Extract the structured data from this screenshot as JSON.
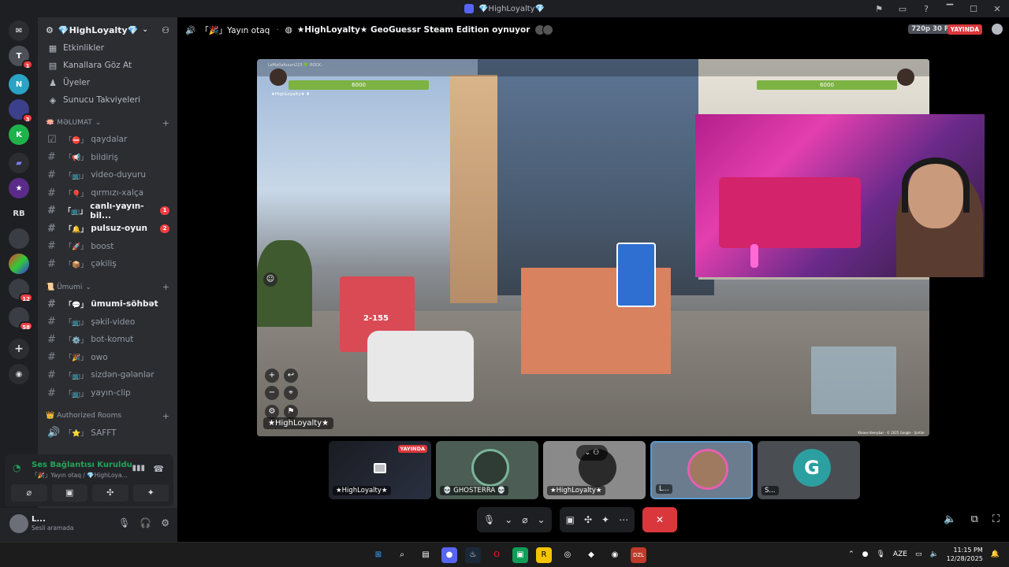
{
  "window": {
    "title": "💎HighLoyalty💎",
    "controls": [
      "▔",
      "☐",
      "✕"
    ]
  },
  "guilds": [
    {
      "label": "",
      "badge": ""
    },
    {
      "label": "T",
      "badge": "1"
    },
    {
      "label": "N",
      "badge": ""
    },
    {
      "label": "",
      "badge": "3"
    },
    {
      "label": "K",
      "badge": ""
    },
    {
      "label": "",
      "badge": ""
    },
    {
      "label": "",
      "badge": ""
    },
    {
      "label": "RB",
      "badge": ""
    },
    {
      "label": "",
      "badge": ""
    },
    {
      "label": "",
      "badge": ""
    },
    {
      "label": "",
      "badge": "12"
    },
    {
      "label": "",
      "badge": "58"
    }
  ],
  "server": {
    "name": "💎HighLoyalty💎",
    "nav": [
      {
        "icon": "calendar-icon",
        "label": "Etkinlikler"
      },
      {
        "icon": "browse-icon",
        "label": "Kanallara Göz At"
      },
      {
        "icon": "members-icon",
        "label": "Üyeler"
      },
      {
        "icon": "boost-icon",
        "label": "Sunucu Takviyeleri"
      }
    ],
    "categories": [
      {
        "name": "🪷 MƏLUMAT",
        "channels": [
          {
            "prefix": "「⛔」",
            "name": "qaydalar",
            "unread": false,
            "pill": ""
          },
          {
            "prefix": "「📢」",
            "name": "bildiriş",
            "unread": false,
            "pill": ""
          },
          {
            "prefix": "「📺」",
            "name": "video-duyuru",
            "unread": false,
            "pill": ""
          },
          {
            "prefix": "「🎈」",
            "name": "qırmızı-xalça",
            "unread": false,
            "pill": ""
          },
          {
            "prefix": "「📺」",
            "name": "canlı-yayın-bil...",
            "unread": true,
            "pill": "1"
          },
          {
            "prefix": "「🔔」",
            "name": "pulsuz-oyun",
            "unread": true,
            "pill": "2"
          },
          {
            "prefix": "「🚀」",
            "name": "boost",
            "unread": false,
            "pill": ""
          },
          {
            "prefix": "「📦」",
            "name": "çəkiliş",
            "unread": false,
            "pill": ""
          }
        ]
      },
      {
        "name": "📜 Ümumi",
        "channels": [
          {
            "prefix": "「💬」",
            "name": "ümumi-söhbət",
            "unread": true,
            "pill": ""
          },
          {
            "prefix": "「📺」",
            "name": "şəkil-video",
            "unread": false,
            "pill": ""
          },
          {
            "prefix": "「⚙️」",
            "name": "bot-komut",
            "unread": false,
            "pill": ""
          },
          {
            "prefix": "「🎉」",
            "name": "owo",
            "unread": false,
            "pill": ""
          },
          {
            "prefix": "「📺」",
            "name": "sizdən-gələnlər",
            "unread": false,
            "pill": ""
          },
          {
            "prefix": "「📺」",
            "name": "yayın-clip",
            "unread": false,
            "pill": ""
          }
        ]
      },
      {
        "name": "👑 Authorized Rooms",
        "channels": [
          {
            "prefix": "「⭐」",
            "name": "SAFFT",
            "unread": false,
            "pill": ""
          }
        ]
      }
    ]
  },
  "voice_panel": {
    "status": "Ses Bağlantısı Kuruldu",
    "channel": "「🎉」Yayın otaq / 💎HighLoya...",
    "buttons": [
      "⌀",
      "▣",
      "✣",
      "✦"
    ]
  },
  "user_panel": {
    "name": "L...",
    "status": "Sesli aramada"
  },
  "stage": {
    "channel": "「🎉」Yayın otaq",
    "activity": "★HighLoyalty★ GeoGuessr Steam Edition oynuyor",
    "quality": "720p 30 FPS",
    "live_label": "YAYINDA",
    "main_label": "★HighLoyalty★",
    "game": {
      "hp_left": "6000",
      "hp_right": "6000",
      "player_top": "LeMa0aAuum223  💚 ROCK  ·",
      "player_sub": "★HighLoyalty★ ♦",
      "bus_number": "2-155",
      "credit": "Kleave Keerybar · © 2025 Google · Şərtlər"
    },
    "tiles": [
      {
        "name": "★HighLoyalty★",
        "live": "YAYINDA",
        "kind": "screen"
      },
      {
        "name": "💀 GHOSTERRA 💀",
        "live": "",
        "kind": "avatar"
      },
      {
        "name": "★HighLoyalty★",
        "live": "",
        "kind": "avatar"
      },
      {
        "name": "L...",
        "live": "",
        "kind": "avatar-active"
      },
      {
        "name": "S...",
        "live": "",
        "kind": "avatar"
      }
    ]
  },
  "taskbar": {
    "lang": "AZE",
    "time": "11:15 PM",
    "date": "12/28/2025",
    "apps": [
      "⊞",
      "⌕",
      "▤",
      "●",
      "♨",
      "O",
      "▣",
      "R",
      "◎",
      "◆",
      "◉",
      "DZL"
    ]
  }
}
